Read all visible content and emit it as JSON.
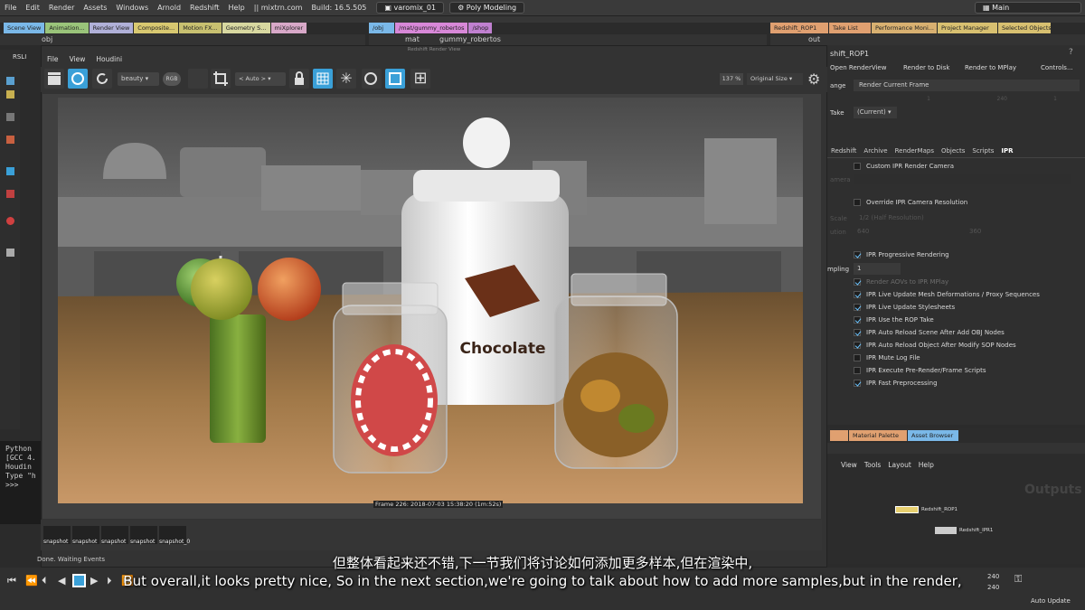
{
  "menu": [
    "File",
    "Edit",
    "Render",
    "Assets",
    "Windows",
    "Arnold",
    "Redshift",
    "Help"
  ],
  "app_info": {
    "site": "mixtrn.com",
    "build": "Build: 16.5.505",
    "file": "varomix_01",
    "mode": "Poly Modeling",
    "desktop": "Main"
  },
  "left_tabs": [
    "Scene View",
    "Animation...",
    "Render View",
    "Composite...",
    "Motion FX...",
    "Geometry S...",
    "miXplorer"
  ],
  "mid_tabs": [
    "/obj",
    "/mat/gummy_robertos",
    "/shop"
  ],
  "right_tabs": [
    "Redshift_ROP1",
    "Take List",
    "Performance Moni...",
    "Project Manager",
    "Selected Objects"
  ],
  "paths": {
    "left": "obj",
    "mid_a": "mat",
    "mid_b": "gummy_robertos",
    "right": "out"
  },
  "render_view": {
    "title_left": "RSLI",
    "window_title": "Redshift Render View",
    "menu": [
      "File",
      "View",
      "Houdini"
    ],
    "aov": "beauty",
    "channel": "RGB",
    "region": "< Auto >",
    "zoom": "137 %",
    "size": "Original Size",
    "frame_info": "Frame 226: 2018-07-03 15:38:20 (1m:52s)",
    "snapshots": [
      "snapshot",
      "snapshot",
      "snapshot",
      "snapshot",
      "snapshot_0"
    ],
    "status": "Done. Waiting Events"
  },
  "scene": {
    "jar_label": "Chocolate"
  },
  "console": [
    "Python",
    "[GCC 4.",
    "Houdin",
    "Type \"h",
    ">>>"
  ],
  "rop": {
    "name": "shift_ROP1",
    "buttons": [
      "Open RenderView",
      "Render to Disk",
      "Render to MPlay",
      "Controls..."
    ],
    "range_label": "ange",
    "range_value": "Render Current Frame",
    "take_label": "Take",
    "take_value": "(Current)",
    "tabs": [
      "Redshift",
      "Archive",
      "RenderMaps",
      "Objects",
      "Scripts",
      "IPR"
    ],
    "custom_camera": "Custom IPR Render Camera",
    "camera_label": "amera",
    "override_res": "Override IPR Camera Resolution",
    "scale_label": "Scale",
    "scale_value": "1/2 (Half Resolution)",
    "res_label": "ution",
    "res_x": "640",
    "res_y": "360",
    "progressive": "IPR Progressive Rendering",
    "sampling_label": "mpling",
    "sampling_value": "1",
    "options": [
      {
        "label": "Render AOVs to IPR MPlay",
        "on": true,
        "dim": true
      },
      {
        "label": "IPR Live Update Mesh Deformations / Proxy Sequences",
        "on": true,
        "dim": false
      },
      {
        "label": "IPR Live Update Stylesheets",
        "on": true,
        "dim": false
      },
      {
        "label": "IPR Use the ROP Take",
        "on": true,
        "dim": false
      },
      {
        "label": "IPR Auto Reload Scene After Add OBJ Nodes",
        "on": true,
        "dim": false
      },
      {
        "label": "IPR Auto Reload Object After Modify SOP Nodes",
        "on": true,
        "dim": false
      },
      {
        "label": "IPR Mute Log File",
        "on": false,
        "dim": false
      },
      {
        "label": "IPR Execute Pre-Render/Frame Scripts",
        "on": false,
        "dim": false
      },
      {
        "label": "IPR Fast Preprocessing",
        "on": true,
        "dim": false
      }
    ],
    "range_nums": [
      "1",
      "240",
      "1"
    ]
  },
  "network": {
    "tabs": [
      "Material Palette",
      "Asset Browser"
    ],
    "menu": [
      "View",
      "Tools",
      "Layout",
      "Help"
    ],
    "title": "Outputs",
    "nodes": [
      "Redshift_ROP1",
      "Redshift_IPR1"
    ]
  },
  "timeline": {
    "end_a": "240",
    "end_b": "240",
    "auto_update": "Auto Update"
  },
  "subtitles": {
    "zh": "但整体看起来还不错,下一节我们将讨论如何添加更多样本,但在渲染中,",
    "en": "But overall,it looks pretty nice, So in the next section,we're going to talk about how to add more samples,but in the render,"
  },
  "colors": {
    "accent": "#3aa0d8",
    "subtitle": "#ffffff",
    "tab_blue": "#7ab8e8",
    "tab_orange": "#e0a070"
  }
}
